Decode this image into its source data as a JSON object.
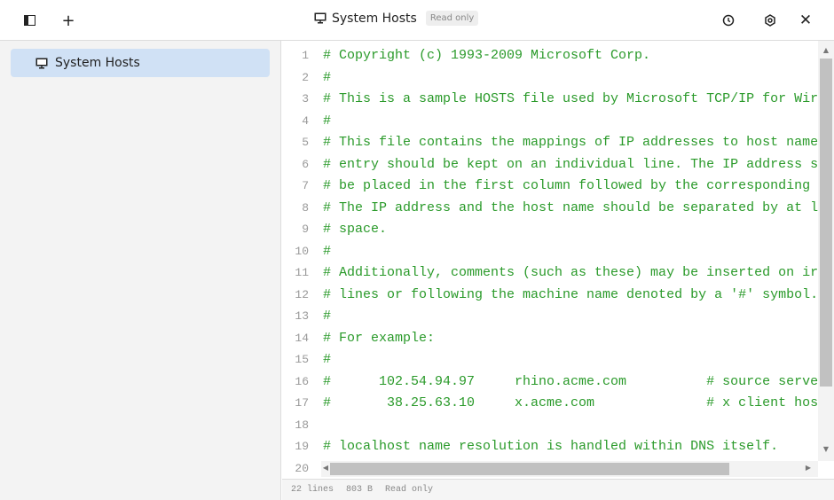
{
  "topbar": {
    "title": "System Hosts",
    "badge": "Read only"
  },
  "sidebar": {
    "items": [
      {
        "label": "System Hosts",
        "selected": true
      }
    ]
  },
  "editor": {
    "lines": [
      "# Copyright (c) 1993-2009 Microsoft Corp.",
      "#",
      "# This is a sample HOSTS file used by Microsoft TCP/IP for Wir",
      "#",
      "# This file contains the mappings of IP addresses to host name",
      "# entry should be kept on an individual line. The IP address s",
      "# be placed in the first column followed by the corresponding ",
      "# The IP address and the host name should be separated by at l",
      "# space.",
      "#",
      "# Additionally, comments (such as these) may be inserted on ir",
      "# lines or following the machine name denoted by a '#' symbol.",
      "#",
      "# For example:",
      "#",
      "#      102.54.94.97     rhino.acme.com          # source serve",
      "#       38.25.63.10     x.acme.com              # x client hos",
      "",
      "# localhost name resolution is handled within DNS itself.",
      ""
    ]
  },
  "status": {
    "lines": "22 lines",
    "size": "803 B",
    "mode": "Read only"
  },
  "colors": {
    "comment": "#2a9a2a",
    "selected": "#d0e1f5"
  }
}
